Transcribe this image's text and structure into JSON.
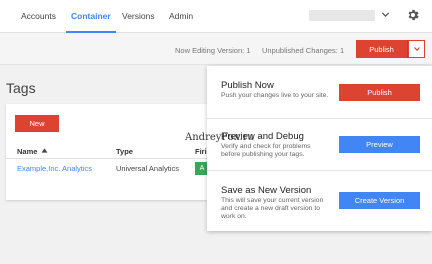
{
  "nav": {
    "tabs": [
      {
        "label": "Accounts",
        "active": false
      },
      {
        "label": "Container",
        "active": true
      },
      {
        "label": "Versions",
        "active": false
      },
      {
        "label": "Admin",
        "active": false
      }
    ],
    "account_selector_icon": "chevron-down-icon",
    "settings_icon": "gear-icon",
    "accent_color": "#4285f4"
  },
  "status_bar": {
    "editing_version": "Now Editing Version: 1",
    "unpublished_changes": "Unpublished Changes: 1",
    "publish_label": "Publish",
    "publish_color": "#dc4431"
  },
  "tags": {
    "page_title": "Tags",
    "new_label": "New",
    "columns": [
      "Name",
      "Type",
      "Firi"
    ],
    "rows": [
      {
        "name": "Example,Inc. Analytics",
        "type": "Universal Analytics",
        "firing": "A"
      }
    ],
    "firing_chip_color": "#3aa757"
  },
  "publish_menu": {
    "options": [
      {
        "title": "Publish Now",
        "description": "Push your changes live to your site.",
        "button": "Publish",
        "button_color": "#dc4431"
      },
      {
        "title": "Preview and Debug",
        "description": "Verify and check for problems before publishing your tags.",
        "button": "Preview",
        "button_color": "#4285f4"
      },
      {
        "title": "Save as New Version",
        "description": "This will save your current version and create a new draft version to work on.",
        "button": "Create Version",
        "button_color": "#4285f4"
      }
    ]
  },
  "watermark": "AndreyFox.ru"
}
